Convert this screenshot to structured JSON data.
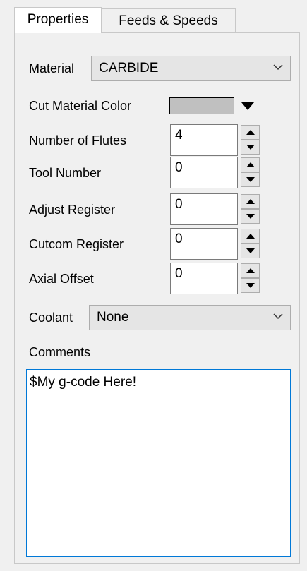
{
  "tabs": [
    {
      "label": "Properties",
      "active": true
    },
    {
      "label": "Feeds & Speeds",
      "active": false
    }
  ],
  "material": {
    "label": "Material",
    "value": "CARBIDE"
  },
  "cut_material_color": {
    "label": "Cut Material Color",
    "color": "#c0c0c0"
  },
  "fields": [
    {
      "label": "Number of Flutes",
      "value": "4"
    },
    {
      "label": "Tool Number",
      "value": "0"
    },
    {
      "label": "Adjust Register",
      "value": "0"
    },
    {
      "label": "Cutcom Register",
      "value": "0"
    },
    {
      "label": "Axial Offset",
      "value": "0"
    }
  ],
  "coolant": {
    "label": "Coolant",
    "value": "None"
  },
  "comments": {
    "label": "Comments",
    "value": "$My g-code Here!"
  },
  "icons": {
    "dropdown": "chevron-down-icon",
    "color_arrow": "triangle-down-icon",
    "spin_up": "spin-up-icon",
    "spin_down": "spin-down-icon"
  }
}
